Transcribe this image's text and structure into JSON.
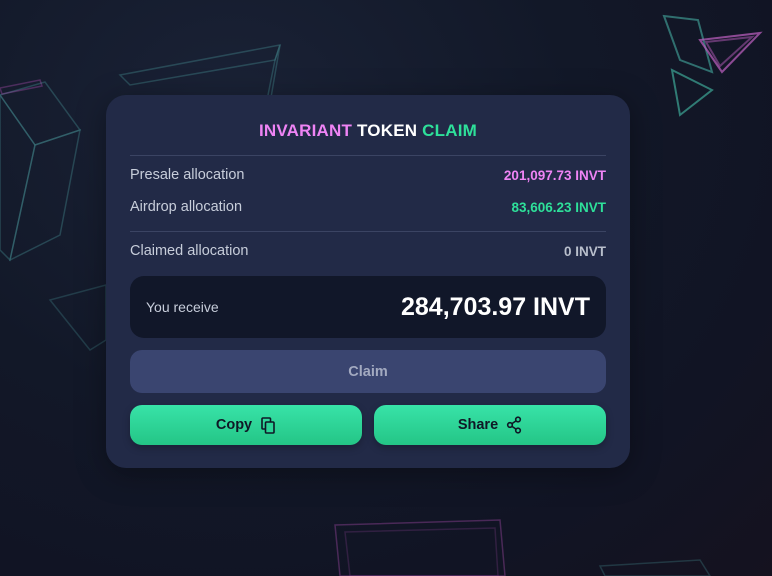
{
  "title": {
    "part1": "INVARIANT",
    "part2": "TOKEN",
    "part3": "CLAIM"
  },
  "allocations": {
    "presale": {
      "label": "Presale allocation",
      "value": "201,097.73 INVT"
    },
    "airdrop": {
      "label": "Airdrop allocation",
      "value": "83,606.23 INVT"
    },
    "claimed": {
      "label": "Claimed allocation",
      "value": "0 INVT"
    }
  },
  "receive": {
    "label": "You receive",
    "amount": "284,703.97 INVT"
  },
  "buttons": {
    "claim": "Claim",
    "copy": "Copy",
    "share": "Share"
  },
  "icons": {
    "copy": "copy-icon",
    "share": "share-icon"
  },
  "colors": {
    "background": "#121828",
    "card": "#222a47",
    "pink_accent": "#ef84f5",
    "green_accent": "#2ee09a",
    "claim_disabled": "#3a4570",
    "receive_box": "#111729"
  }
}
